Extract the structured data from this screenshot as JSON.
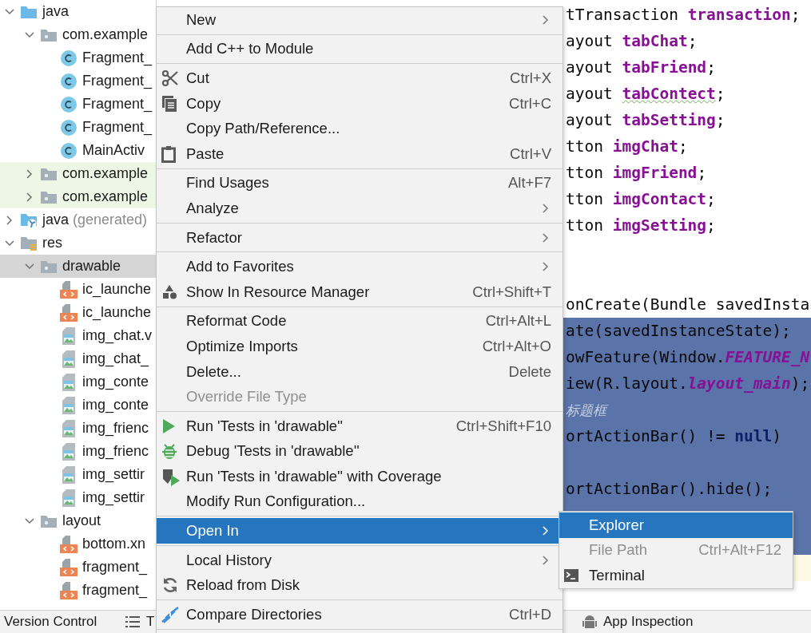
{
  "project_tree": [
    {
      "label": "java",
      "kind": "source-folder",
      "expanded": true,
      "selected": false,
      "test_source": false,
      "children": [
        {
          "label": "com.example",
          "kind": "package",
          "expanded": true,
          "selected": false,
          "test_source": false,
          "children": [
            {
              "label": "Fragment_",
              "kind": "class",
              "selected": false,
              "test_source": false
            },
            {
              "label": "Fragment_",
              "kind": "class",
              "selected": false,
              "test_source": false
            },
            {
              "label": "Fragment_",
              "kind": "class",
              "selected": false,
              "test_source": false
            },
            {
              "label": "Fragment_",
              "kind": "class",
              "selected": false,
              "test_source": false
            },
            {
              "label": "MainActiv",
              "kind": "class",
              "selected": false,
              "test_source": false
            }
          ]
        },
        {
          "label": "com.example",
          "kind": "package",
          "expanded": false,
          "selected": false,
          "test_source": true
        },
        {
          "label": "com.example",
          "kind": "package",
          "expanded": false,
          "selected": false,
          "test_source": true
        }
      ]
    },
    {
      "label": "java",
      "note": "(generated)",
      "kind": "generated-folder",
      "expanded": false,
      "selected": false,
      "test_source": false
    },
    {
      "label": "res",
      "kind": "res-folder",
      "expanded": true,
      "selected": false,
      "test_source": false,
      "children": [
        {
          "label": "drawable",
          "kind": "package",
          "expanded": true,
          "selected": true,
          "test_source": false,
          "children": [
            {
              "label": "ic_launche",
              "kind": "xml",
              "selected": false,
              "test_source": false
            },
            {
              "label": "ic_launche",
              "kind": "xml",
              "selected": false,
              "test_source": false
            },
            {
              "label": "img_chat.v",
              "kind": "image",
              "selected": false,
              "test_source": false
            },
            {
              "label": "img_chat_",
              "kind": "image",
              "selected": false,
              "test_source": false
            },
            {
              "label": "img_conte",
              "kind": "image",
              "selected": false,
              "test_source": false
            },
            {
              "label": "img_conte",
              "kind": "image",
              "selected": false,
              "test_source": false
            },
            {
              "label": "img_frienc",
              "kind": "image",
              "selected": false,
              "test_source": false
            },
            {
              "label": "img_frienc",
              "kind": "image",
              "selected": false,
              "test_source": false
            },
            {
              "label": "img_settir",
              "kind": "image",
              "selected": false,
              "test_source": false
            },
            {
              "label": "img_settir",
              "kind": "image",
              "selected": false,
              "test_source": false
            }
          ]
        },
        {
          "label": "layout",
          "kind": "package",
          "expanded": true,
          "selected": false,
          "test_source": false,
          "children": [
            {
              "label": "bottom.xn",
              "kind": "xml",
              "selected": false,
              "test_source": false
            },
            {
              "label": "fragment_",
              "kind": "xml",
              "selected": false,
              "test_source": false
            },
            {
              "label": "fragment_",
              "kind": "xml",
              "selected": false,
              "test_source": false
            }
          ]
        }
      ]
    }
  ],
  "editor": {
    "lines": [
      {
        "selected": false,
        "current": false,
        "segments": [
          {
            "kind": "plain",
            "text": "tTransaction "
          },
          {
            "kind": "field",
            "text": "transaction"
          },
          {
            "kind": "plain",
            "text": ";"
          }
        ]
      },
      {
        "selected": false,
        "current": false,
        "segments": [
          {
            "kind": "plain",
            "text": "ayout "
          },
          {
            "kind": "field",
            "text": "tabChat"
          },
          {
            "kind": "plain",
            "text": ";"
          }
        ]
      },
      {
        "selected": false,
        "current": false,
        "segments": [
          {
            "kind": "plain",
            "text": "ayout "
          },
          {
            "kind": "field",
            "text": "tabFriend"
          },
          {
            "kind": "plain",
            "text": ";"
          }
        ]
      },
      {
        "selected": false,
        "current": false,
        "segments": [
          {
            "kind": "plain",
            "text": "ayout "
          },
          {
            "kind": "typo",
            "text": "tabContect"
          },
          {
            "kind": "plain",
            "text": ";"
          }
        ]
      },
      {
        "selected": false,
        "current": false,
        "segments": [
          {
            "kind": "plain",
            "text": "ayout "
          },
          {
            "kind": "field",
            "text": "tabSetting"
          },
          {
            "kind": "plain",
            "text": ";"
          }
        ]
      },
      {
        "selected": false,
        "current": false,
        "segments": [
          {
            "kind": "plain",
            "text": "tton "
          },
          {
            "kind": "field",
            "text": "imgChat"
          },
          {
            "kind": "plain",
            "text": ";"
          }
        ]
      },
      {
        "selected": false,
        "current": false,
        "segments": [
          {
            "kind": "plain",
            "text": "tton "
          },
          {
            "kind": "field",
            "text": "imgFriend"
          },
          {
            "kind": "plain",
            "text": ";"
          }
        ]
      },
      {
        "selected": false,
        "current": false,
        "segments": [
          {
            "kind": "plain",
            "text": "tton "
          },
          {
            "kind": "field",
            "text": "imgContact"
          },
          {
            "kind": "plain",
            "text": ";"
          }
        ]
      },
      {
        "selected": false,
        "current": false,
        "segments": [
          {
            "kind": "plain",
            "text": "tton "
          },
          {
            "kind": "field",
            "text": "imgSetting"
          },
          {
            "kind": "plain",
            "text": ";"
          }
        ]
      },
      {
        "selected": false,
        "current": false
      },
      {
        "selected": false,
        "current": false
      },
      {
        "selected": false,
        "current": false,
        "segments": [
          {
            "kind": "plain",
            "text": "onCreate(Bundle savedInsta"
          }
        ]
      },
      {
        "selected": true,
        "current": false,
        "segments": [
          {
            "kind": "plain",
            "text": "ate(savedInstanceState);"
          }
        ]
      },
      {
        "selected": true,
        "current": false,
        "segments": [
          {
            "kind": "plain",
            "text": "owFeature(Window."
          },
          {
            "kind": "static",
            "text": "FEATURE_N"
          }
        ]
      },
      {
        "selected": true,
        "current": false,
        "segments": [
          {
            "kind": "plain",
            "text": "iew(R.layout."
          },
          {
            "kind": "static",
            "text": "layout_main"
          },
          {
            "kind": "plain",
            "text": ");"
          }
        ]
      },
      {
        "selected": true,
        "current": false,
        "segments": [
          {
            "kind": "comment",
            "text": "标题框"
          }
        ]
      },
      {
        "selected": true,
        "current": false,
        "segments": [
          {
            "kind": "plain",
            "text": "ortActionBar() != "
          },
          {
            "kind": "keyword",
            "text": "null"
          },
          {
            "kind": "plain",
            "text": ")"
          }
        ]
      },
      {
        "selected": true,
        "current": false
      },
      {
        "selected": true,
        "current": false,
        "segments": [
          {
            "kind": "plain",
            "text": "ortActionBar().hide();"
          }
        ]
      },
      {
        "selected": true,
        "current": false
      },
      {
        "selected": true,
        "current": false
      },
      {
        "selected": false,
        "current": true
      }
    ]
  },
  "status_bar": {
    "items": [
      {
        "label": "Version Control",
        "kind": "plain"
      },
      {
        "label": "T",
        "kind": "list"
      },
      {
        "label": "App Inspection",
        "kind": "robot"
      }
    ]
  },
  "context_menu": {
    "items": [
      {
        "kind": "plain",
        "label": "New",
        "has_submenu": true,
        "disabled": false,
        "selected": false
      },
      {
        "kind": "separator"
      },
      {
        "kind": "plain",
        "label": "Add C++ to Module",
        "has_submenu": false,
        "disabled": false,
        "selected": false
      },
      {
        "kind": "separator"
      },
      {
        "kind": "scissors",
        "label": "Cut",
        "shortcut": "Ctrl+X",
        "has_submenu": false,
        "disabled": false,
        "selected": false
      },
      {
        "kind": "copy",
        "label": "Copy",
        "shortcut": "Ctrl+C",
        "has_submenu": false,
        "disabled": false,
        "selected": false
      },
      {
        "kind": "plain",
        "label": "Copy Path/Reference...",
        "has_submenu": false,
        "disabled": false,
        "selected": false
      },
      {
        "kind": "paste",
        "label": "Paste",
        "shortcut": "Ctrl+V",
        "has_submenu": false,
        "disabled": false,
        "selected": false
      },
      {
        "kind": "separator"
      },
      {
        "kind": "plain",
        "label": "Find Usages",
        "shortcut": "Alt+F7",
        "has_submenu": false,
        "disabled": false,
        "selected": false
      },
      {
        "kind": "plain",
        "label": "Analyze",
        "has_submenu": true,
        "disabled": false,
        "selected": false
      },
      {
        "kind": "separator"
      },
      {
        "kind": "plain",
        "label": "Refactor",
        "has_submenu": true,
        "disabled": false,
        "selected": false
      },
      {
        "kind": "separator"
      },
      {
        "kind": "plain",
        "label": "Add to Favorites",
        "has_submenu": true,
        "disabled": false,
        "selected": false
      },
      {
        "kind": "shapes",
        "label": "Show In Resource Manager",
        "shortcut": "Ctrl+Shift+T",
        "has_submenu": false,
        "disabled": false,
        "selected": false
      },
      {
        "kind": "separator"
      },
      {
        "kind": "plain",
        "label": "Reformat Code",
        "shortcut": "Ctrl+Alt+L",
        "has_submenu": false,
        "disabled": false,
        "selected": false
      },
      {
        "kind": "plain",
        "label": "Optimize Imports",
        "shortcut": "Ctrl+Alt+O",
        "has_submenu": false,
        "disabled": false,
        "selected": false
      },
      {
        "kind": "plain",
        "label": "Delete...",
        "shortcut": "Delete",
        "has_submenu": false,
        "disabled": false,
        "selected": false
      },
      {
        "kind": "plain",
        "label": "Override File Type",
        "has_submenu": false,
        "disabled": true,
        "selected": false
      },
      {
        "kind": "separator"
      },
      {
        "kind": "run",
        "label": "Run 'Tests in 'drawable''",
        "shortcut": "Ctrl+Shift+F10",
        "has_submenu": false,
        "disabled": false,
        "selected": false
      },
      {
        "kind": "bug",
        "label": "Debug 'Tests in 'drawable''",
        "has_submenu": false,
        "disabled": false,
        "selected": false
      },
      {
        "kind": "coverage",
        "label": "Run 'Tests in 'drawable'' with Coverage",
        "has_submenu": false,
        "disabled": false,
        "selected": false
      },
      {
        "kind": "plain",
        "label": "Modify Run Configuration...",
        "has_submenu": false,
        "disabled": false,
        "selected": false
      },
      {
        "kind": "separator"
      },
      {
        "kind": "plain",
        "label": "Open In",
        "has_submenu": true,
        "disabled": false,
        "selected": true
      },
      {
        "kind": "separator"
      },
      {
        "kind": "plain",
        "label": "Local History",
        "has_submenu": true,
        "disabled": false,
        "selected": false
      },
      {
        "kind": "reload",
        "label": "Reload from Disk",
        "has_submenu": false,
        "disabled": false,
        "selected": false
      },
      {
        "kind": "separator"
      },
      {
        "kind": "compare",
        "label": "Compare Directories",
        "shortcut": "Ctrl+D",
        "has_submenu": false,
        "disabled": false,
        "selected": false
      },
      {
        "kind": "separator"
      }
    ]
  },
  "submenu": {
    "items": [
      {
        "kind": "plain",
        "label": "Explorer",
        "has_submenu": false,
        "disabled": false,
        "selected": true
      },
      {
        "kind": "plain",
        "label": "File Path",
        "shortcut": "Ctrl+Alt+F12",
        "has_submenu": false,
        "disabled": true,
        "selected": false
      },
      {
        "kind": "terminal",
        "label": "Terminal",
        "has_submenu": false,
        "disabled": false,
        "selected": false
      }
    ]
  }
}
